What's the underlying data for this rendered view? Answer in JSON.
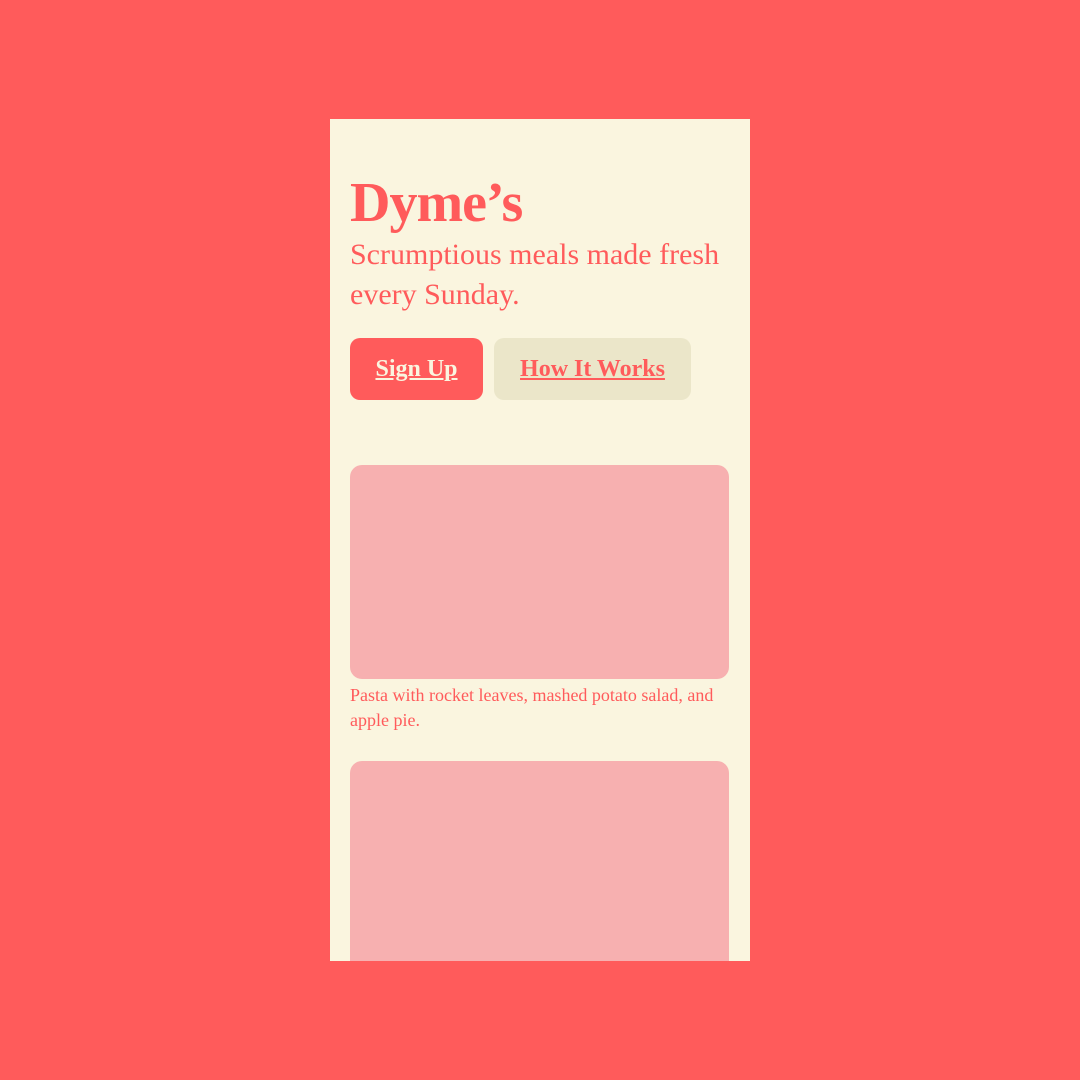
{
  "colors": {
    "background": "#ff5b5b",
    "surface": "#faf5df",
    "accent": "#ff5b5b",
    "secondary_button": "#ebe6c9",
    "image_placeholder": "#f7b0b0"
  },
  "hero": {
    "brand": "Dyme’s",
    "tagline": "Scrumptious meals made fresh every Sunday."
  },
  "actions": {
    "sign_up_label": "Sign Up",
    "how_it_works_label": "How It Works"
  },
  "meals": [
    {
      "caption": "Pasta with rocket leaves, mashed potato salad, and apple pie."
    },
    {
      "caption": ""
    }
  ]
}
